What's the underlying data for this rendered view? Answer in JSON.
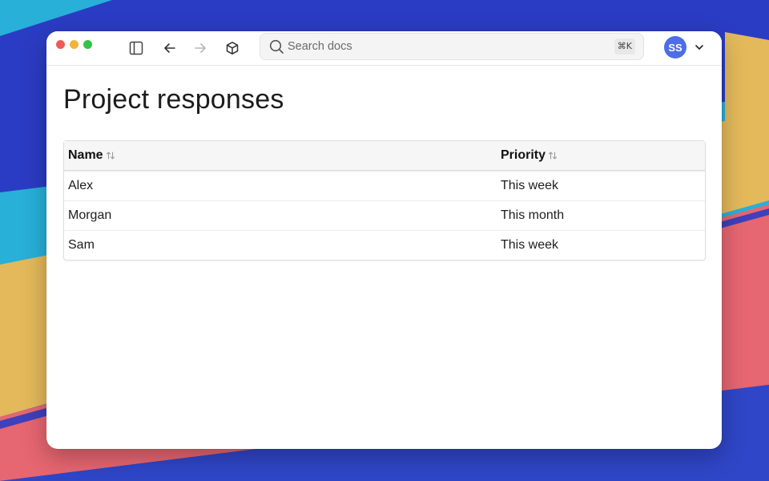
{
  "window": {
    "controls": [
      "close",
      "minimize",
      "zoom"
    ]
  },
  "toolbar": {
    "icons": [
      "sidebar-toggle-icon",
      "arrow-left-icon",
      "arrow-right-icon",
      "cube-icon"
    ],
    "search": {
      "placeholder": "Search docs",
      "value": "",
      "shortcut": "⌘K"
    },
    "user": {
      "initials": "SS",
      "avatar_color": "#4d6ee6"
    }
  },
  "page": {
    "title": "Project responses"
  },
  "table": {
    "columns": [
      "Name",
      "Priority"
    ],
    "rows": [
      [
        "Alex",
        "This week"
      ],
      [
        "Morgan",
        "This month"
      ],
      [
        "Sam",
        "This week"
      ]
    ]
  },
  "colors": {
    "background_blue": "#2b3cc4",
    "background_yellow": "#e3b95b",
    "background_red": "#e66671",
    "background_cyan": "#28b0d8"
  }
}
